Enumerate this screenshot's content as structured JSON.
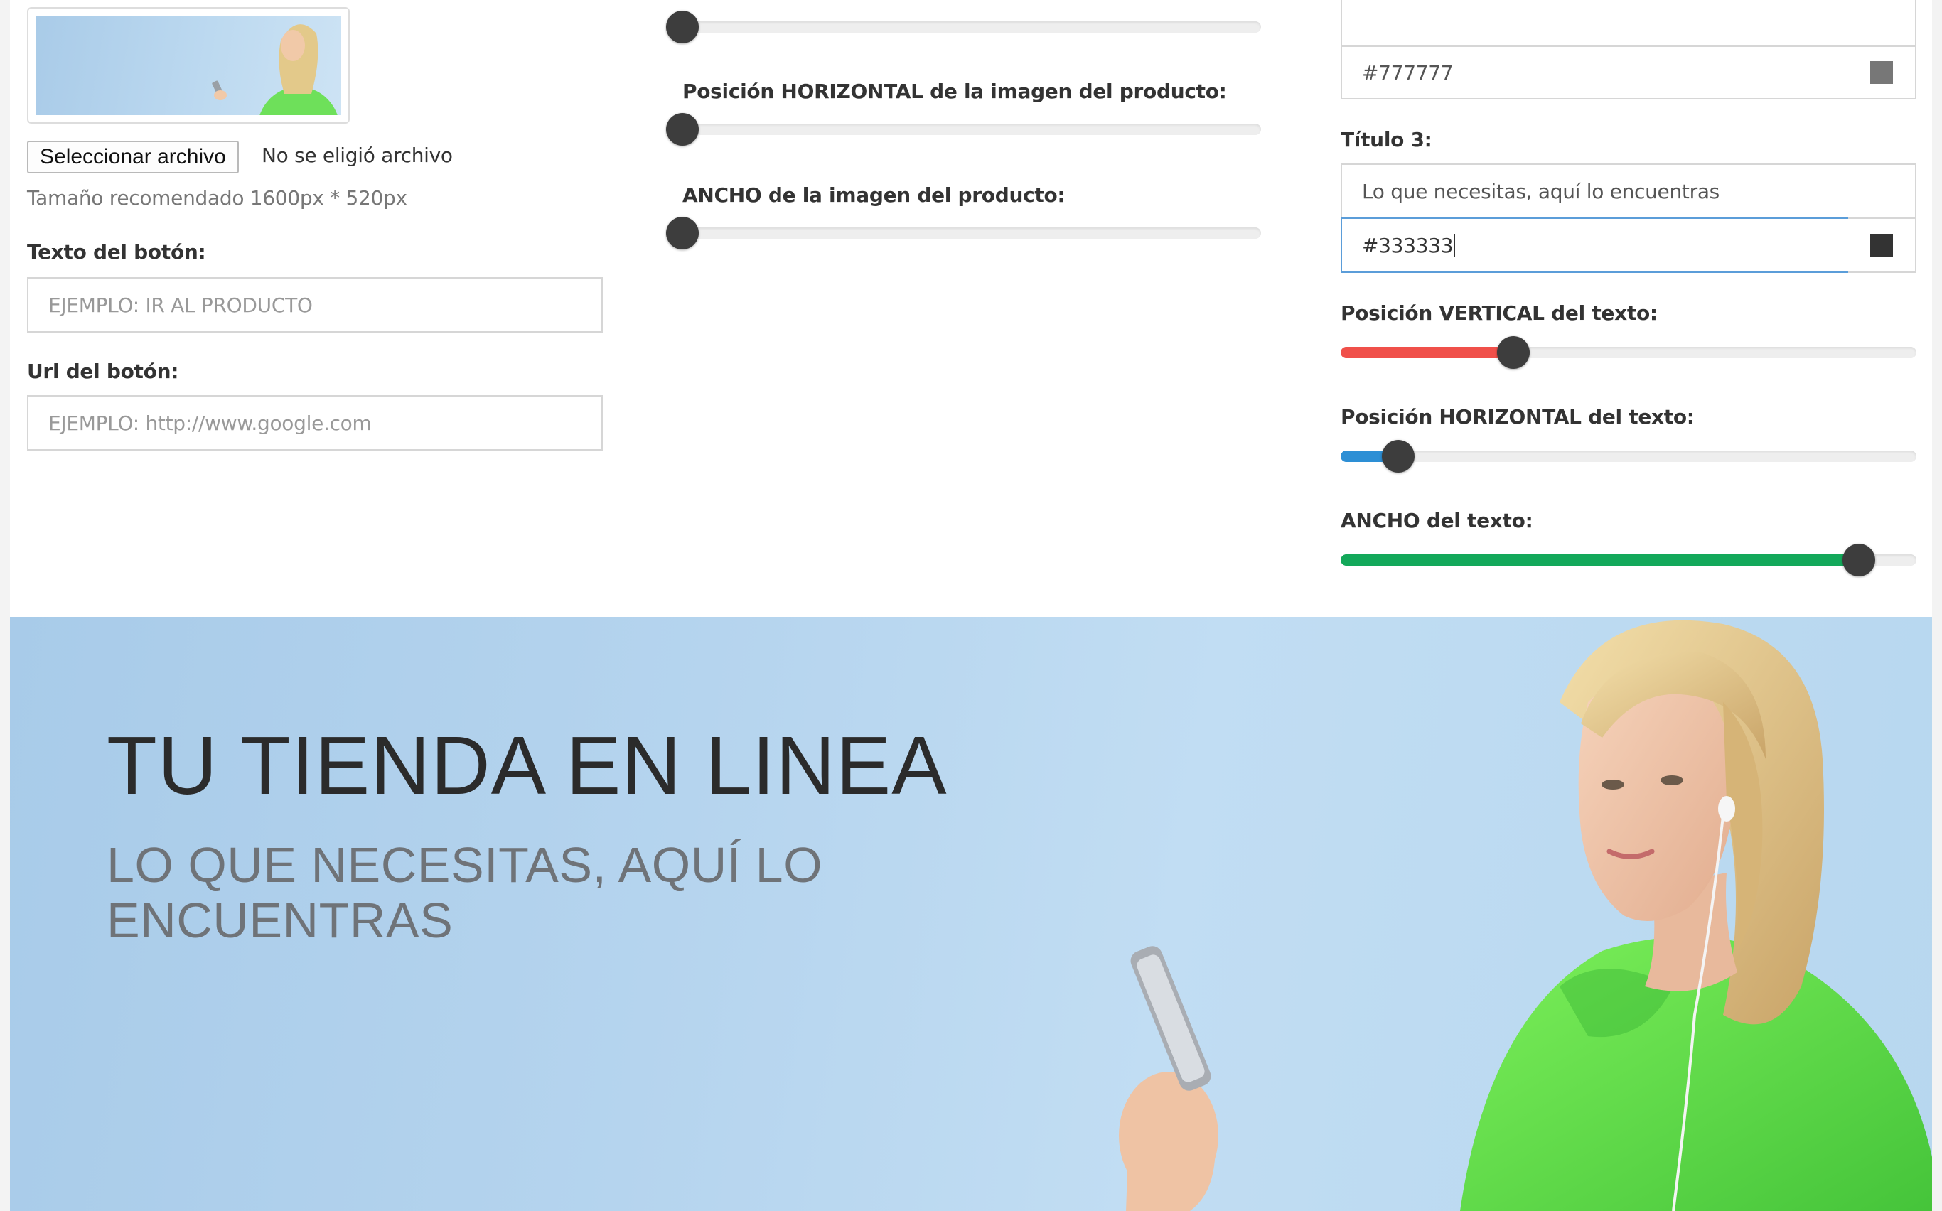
{
  "left_column": {
    "file_button_label": "Seleccionar archivo",
    "file_status": "No se eligió archivo",
    "recommended_size": "Tamaño recomendado 1600px * 520px",
    "button_text_label": "Texto del botón:",
    "button_text_placeholder": "EJEMPLO: IR AL PRODUCTO",
    "button_url_label": "Url del botón:",
    "button_url_placeholder": "EJEMPLO: http://www.google.com"
  },
  "middle_column": {
    "sliders": [
      {
        "label": "",
        "value": 0
      },
      {
        "label": "Posición HORIZONTAL de la imagen del producto:",
        "value": 0
      },
      {
        "label": "ANCHO de la imagen del producto:",
        "value": 0
      }
    ]
  },
  "right_column": {
    "color_2_value": "#777777",
    "color_2_swatch": "#777777",
    "title3_label": "Título 3:",
    "title3_value": "Lo que necesitas, aquí lo encuentras",
    "color_3_value": "#333333",
    "color_3_swatch": "#333333",
    "sliders": [
      {
        "label": "Posición VERTICAL del texto:",
        "value": 30,
        "color": "#f0504a"
      },
      {
        "label": "Posición HORIZONTAL del texto:",
        "value": 10,
        "color": "#2d8fd5"
      },
      {
        "label": "ANCHO del texto:",
        "value": 90,
        "color": "#13a85a"
      }
    ]
  },
  "preview": {
    "title": "TU TIENDA EN LINEA",
    "subtitle": "LO QUE NECESITAS, AQUÍ LO ENCUENTRAS"
  }
}
